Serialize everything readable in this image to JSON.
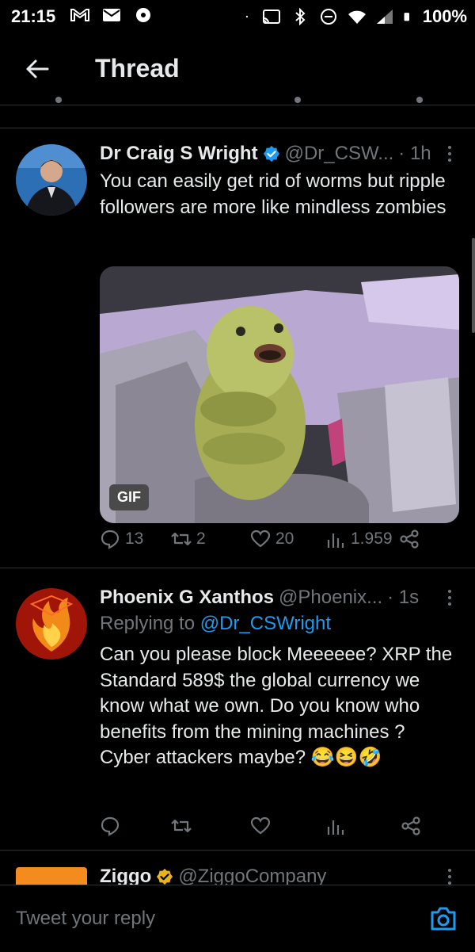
{
  "status": {
    "time": "21:15",
    "battery": "100%"
  },
  "appbar": {
    "title": "Thread"
  },
  "tweets": [
    {
      "name": "Dr Craig S Wright",
      "handle": "@Dr_CSW...",
      "time": "· 1h",
      "text": "You can easily get rid of worms but ripple followers are more like mindless zombies",
      "gif_label": "GIF",
      "stats": {
        "replies": "13",
        "retweets": "2",
        "likes": "20",
        "views": "1.959"
      }
    },
    {
      "name": "Phoenix G Xanthos",
      "handle": "@Phoenix...",
      "time": "· 1s",
      "replying_prefix": "Replying to ",
      "replying_handle": "@Dr_CSWright",
      "text": "Can you please block Meeeeee?  XRP the Standard 589$ the global currency we know what we own. Do you know who benefits from the mining machines ? Cyber attackers maybe? 😂😆🤣"
    },
    {
      "name": "Ziggo",
      "handle": "@ZiggoCompany"
    }
  ],
  "reply_bar": {
    "placeholder": "Tweet your reply"
  },
  "colors": {
    "accent": "#1d9bf0",
    "muted": "#71767b",
    "background": "#000000"
  }
}
